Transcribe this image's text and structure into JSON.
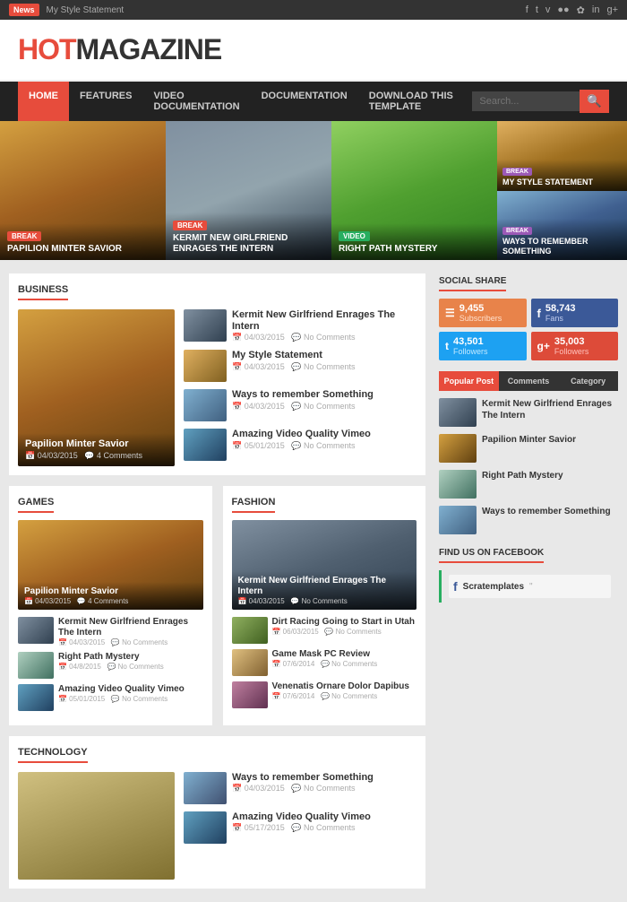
{
  "topbar": {
    "badge": "News",
    "tagline": "My Style Statement",
    "icons": [
      "f",
      "t",
      "v",
      "●●",
      "✿",
      "in",
      "g+"
    ]
  },
  "header": {
    "title_hot": "HOT",
    "title_mag": "MAGAZINE"
  },
  "nav": {
    "items": [
      {
        "label": "HOME",
        "active": true
      },
      {
        "label": "FEATURES",
        "active": false
      },
      {
        "label": "VIDEO DOCUMENTATION",
        "active": false
      },
      {
        "label": "DOCUMENTATION",
        "active": false
      },
      {
        "label": "DOWNLOAD THIS TEMPLATE",
        "active": false
      }
    ],
    "search_placeholder": "Search..."
  },
  "hero": {
    "slides": [
      {
        "tag": "BREAK",
        "tag_type": "break",
        "title": "PAPILION MINTER SAVIOR",
        "bg": "bus"
      },
      {
        "tag": "BREAK",
        "tag_type": "break",
        "title": "KERMIT NEW GIRLFRIEND ENRAGES THE INTERN",
        "bg": "friends"
      },
      {
        "tag": "VIDEO",
        "tag_type": "video",
        "title": "RIGHT PATH MYSTERY",
        "bg": "kite"
      },
      {
        "tag": "BREAK",
        "tag_type": "break",
        "title": "MY STYLE STATEMENT",
        "bg": "mystate",
        "small": true
      },
      {
        "tag": "BREAK",
        "tag_type": "break",
        "title": "WAYS TO REMEMBER SOMETHING",
        "bg": "bicycle",
        "small": true
      }
    ]
  },
  "business": {
    "section_title": "BUSINESS",
    "main_article": {
      "title": "Papilion Minter Savior",
      "date": "04/03/2015",
      "comments": "4 Comments"
    },
    "list_articles": [
      {
        "title": "Kermit New Girlfriend Enrages The Intern",
        "date": "04/03/2015",
        "comments": "No Comments",
        "thumb": "friends"
      },
      {
        "title": "My Style Statement",
        "date": "04/03/2015",
        "comments": "No Comments",
        "thumb": "mystate"
      },
      {
        "title": "Ways to remember Something",
        "date": "04/03/2015",
        "comments": "No Comments",
        "thumb": "bicycle"
      },
      {
        "title": "Amazing Video Quality Vimeo",
        "date": "05/01/2015",
        "comments": "No Comments",
        "thumb": "video"
      }
    ]
  },
  "games": {
    "section_title": "GAMES",
    "main_article": {
      "title": "Papilion Minter Savior",
      "date": "04/03/2015",
      "comments": "4 Comments",
      "bg": "bus"
    },
    "list_articles": [
      {
        "title": "Kermit New Girlfriend Enrages The Intern",
        "date": "04/03/2015",
        "comments": "No Comments",
        "thumb": "friends"
      },
      {
        "title": "Right Path Mystery",
        "date": "04/8/2015",
        "comments": "No Comments",
        "thumb": "mystery"
      },
      {
        "title": "Amazing Video Quality Vimeo",
        "date": "05/01/2015",
        "comments": "No Comments",
        "thumb": "video"
      }
    ]
  },
  "fashion": {
    "section_title": "FASHION",
    "main_article": {
      "title": "Kermit New Girlfriend Enrages The Intern",
      "date": "04/03/2015",
      "comments": "No Comments",
      "bg": "friends"
    },
    "list_articles": [
      {
        "title": "Dirt Racing Going to Start in Utah",
        "date": "06/03/2015",
        "comments": "No Comments",
        "thumb": "dirt"
      },
      {
        "title": "Game Mask PC Review",
        "date": "07/6/2014",
        "comments": "No Comments",
        "thumb": "mask"
      },
      {
        "title": "Venenatis Ornare Dolor Dapibus",
        "date": "07/6/2014",
        "comments": "No Comments",
        "thumb": "venenatis"
      }
    ]
  },
  "technology": {
    "section_title": "TECHNOLOGY",
    "list_articles": [
      {
        "title": "Ways to remember Something",
        "date": "04/03/2015",
        "comments": "No Comments",
        "thumb": "ways"
      },
      {
        "title": "Amazing Video Quality Vimeo",
        "date": "05/17/2015",
        "comments": "No Comments",
        "thumb": "video"
      }
    ]
  },
  "sidebar": {
    "social_title": "SOCIAL SHARE",
    "social": {
      "rss": {
        "count": "9,455",
        "label": "Subscribers"
      },
      "fb": {
        "count": "58,743",
        "label": "Fans"
      },
      "tw": {
        "count": "43,501",
        "label": "Followers"
      },
      "gp": {
        "count": "35,003",
        "label": "Followers"
      }
    },
    "tabs": [
      "Popular Post",
      "Comments",
      "Category"
    ],
    "popular_articles": [
      {
        "title": "Kermit New Girlfriend Enrages The Intern",
        "thumb": "friends"
      },
      {
        "title": "Papilion Minter Savior",
        "thumb": "bus"
      },
      {
        "title": "Right Path Mystery",
        "thumb": "mystery"
      },
      {
        "title": "Ways to remember Something",
        "thumb": "bicycle"
      }
    ],
    "facebook_title": "FIND US ON FACEBOOK",
    "fb_page": "Scratemplates"
  }
}
